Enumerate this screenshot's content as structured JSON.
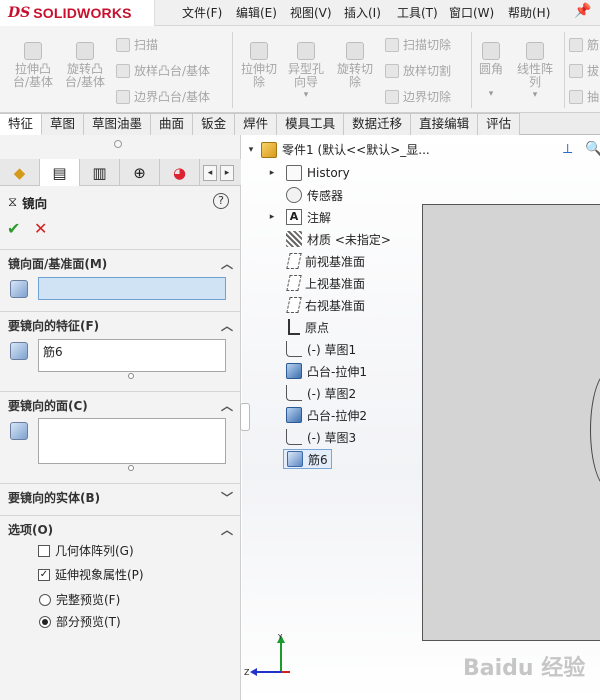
{
  "app": {
    "logo_mark": "DS",
    "brand": "SOLIDWORKS",
    "menus": [
      "文件(F)",
      "编辑(E)",
      "视图(V)",
      "插入(I)",
      "工具(T)",
      "窗口(W)",
      "帮助(H)"
    ],
    "pin_icon": "pin-icon",
    "accent_color": "#c8102e"
  },
  "ribbon": {
    "extrude_boss": "拉伸凸台/基体",
    "revolve_boss": "旋转凸台/基体",
    "sweep": "扫描",
    "loft_boss": "放样凸台/基体",
    "boundary_boss": "边界凸台/基体",
    "extrude_cut": "拉伸切除",
    "hole_wizard": "异型孔向导",
    "revolve_cut": "旋转切除",
    "sweep_cut": "扫描切除",
    "loft_cut": "放样切割",
    "boundary_cut": "边界切除",
    "fillet": "圆角",
    "linear_pattern": "线性阵列",
    "rib_partial": "筋",
    "draft_partial": "拔",
    "shell_partial": "抽"
  },
  "tabs": [
    "特征",
    "草图",
    "草图油墨",
    "曲面",
    "钣金",
    "焊件",
    "模具工具",
    "数据迁移",
    "直接编辑",
    "评估"
  ],
  "active_tab": "特征",
  "panel": {
    "title": "镜向",
    "ok_symbol": "✔",
    "cancel_symbol": "✕",
    "help_symbol": "?",
    "mirror_plane": {
      "label": "镜向面/基准面(M)",
      "value": ""
    },
    "features": {
      "label": "要镜向的特征(F)",
      "value": "筋6"
    },
    "faces": {
      "label": "要镜向的面(C)",
      "value": ""
    },
    "bodies": {
      "label": "要镜向的实体(B)"
    },
    "options": {
      "label": "选项(O)",
      "geometry_pattern": {
        "label": "几何体阵列(G)",
        "checked": false
      },
      "propagate_visual": {
        "label": "延伸视象属性(P)",
        "checked": true
      },
      "full_preview": {
        "label": "完整预览(F)",
        "selected": false
      },
      "partial_preview": {
        "label": "部分预览(T)",
        "selected": true
      }
    }
  },
  "tree": {
    "root": "零件1 (默认<<默认>_显...",
    "items": [
      {
        "label": "History",
        "icon": "history-icon",
        "expandable": true
      },
      {
        "label": "传感器",
        "icon": "sensor-icon",
        "expandable": false
      },
      {
        "label": "注解",
        "icon": "annotation-icon",
        "expandable": true
      },
      {
        "label": "材质 <未指定>",
        "icon": "material-icon",
        "expandable": false
      },
      {
        "label": "前视基准面",
        "icon": "plane-icon",
        "expandable": false
      },
      {
        "label": "上视基准面",
        "icon": "plane-icon",
        "expandable": false
      },
      {
        "label": "右视基准面",
        "icon": "plane-icon",
        "expandable": false
      },
      {
        "label": "原点",
        "icon": "origin-icon",
        "expandable": false
      },
      {
        "label": "(-) 草图1",
        "icon": "sketch-icon",
        "expandable": false
      },
      {
        "label": "凸台-拉伸1",
        "icon": "boss-extrude-icon",
        "expandable": false
      },
      {
        "label": "(-) 草图2",
        "icon": "sketch-icon",
        "expandable": false
      },
      {
        "label": "凸台-拉伸2",
        "icon": "boss-extrude-icon",
        "expandable": false
      },
      {
        "label": "(-) 草图3",
        "icon": "sketch-icon",
        "expandable": false
      },
      {
        "label": "筋6",
        "icon": "rib-icon",
        "expandable": false,
        "selected": true
      }
    ]
  },
  "triad": {
    "y": "Y",
    "z": "Z"
  },
  "watermark": "Baidu 经验"
}
